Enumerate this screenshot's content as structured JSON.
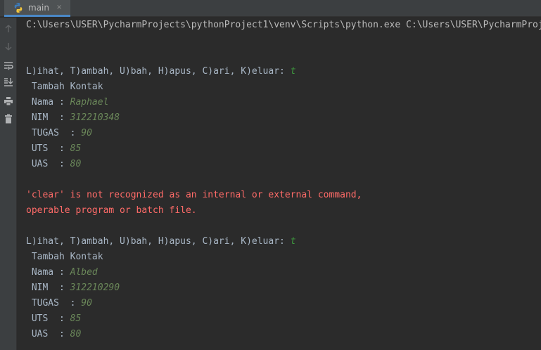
{
  "tab": {
    "label": "main",
    "close": "×",
    "icon": "python-icon"
  },
  "toolbar": {
    "icons": [
      "arrow-up-icon",
      "arrow-down-icon",
      "soft-wrap-icon",
      "scroll-to-end-icon",
      "print-icon",
      "trash-icon"
    ]
  },
  "console": {
    "command": "C:\\Users\\USER\\PycharmProjects\\pythonProject1\\venv\\Scripts\\python.exe C:\\Users\\USER\\PycharmProj",
    "block1": {
      "prompt": "L)ihat, T)ambah, U)bah, H)apus, C)ari, K)eluar: ",
      "choice": "t",
      "heading": " Tambah Kontak",
      "nama_label": " Nama : ",
      "nama_value": "Raphael",
      "nim_label": " NIM  : ",
      "nim_value": "312210348",
      "tugas_label": " TUGAS  : ",
      "tugas_value": "90",
      "uts_label": " UTS  : ",
      "uts_value": "85",
      "uas_label": " UAS  : ",
      "uas_value": "80"
    },
    "error_line1": "'clear' is not recognized as an internal or external command,",
    "error_line2": "operable program or batch file.",
    "block2": {
      "prompt": "L)ihat, T)ambah, U)bah, H)apus, C)ari, K)eluar: ",
      "choice": "t",
      "heading": " Tambah Kontak",
      "nama_label": " Nama : ",
      "nama_value": "Albed",
      "nim_label": " NIM  : ",
      "nim_value": "312210290",
      "tugas_label": " TUGAS  : ",
      "tugas_value": "90",
      "uts_label": " UTS  : ",
      "uts_value": "85",
      "uas_label": " UAS  : ",
      "uas_value": "80"
    }
  }
}
